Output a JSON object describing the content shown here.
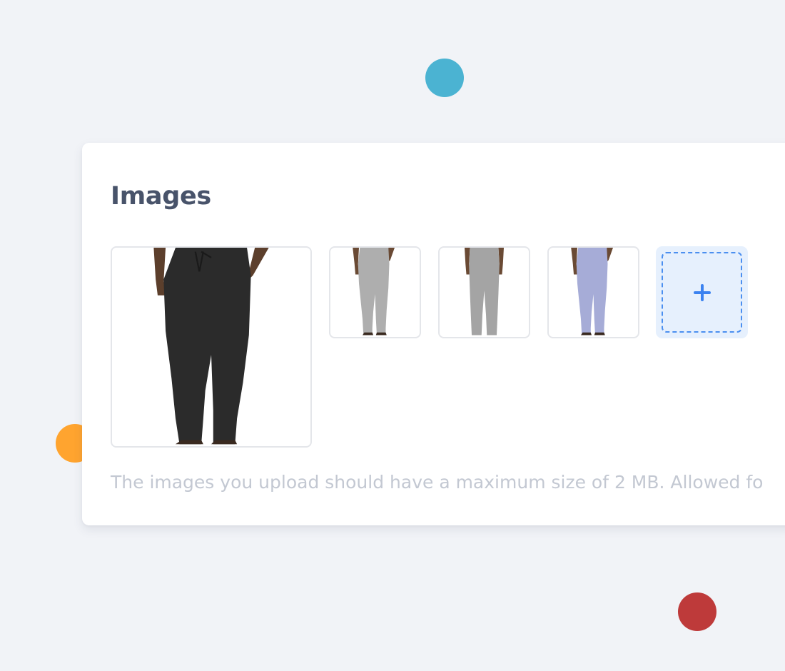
{
  "card": {
    "title": "Images",
    "hint": "The images you upload should have a maximum size of 2 MB. Allowed fo"
  },
  "images": [
    {
      "id": "main",
      "alt": "Black pants",
      "color": "#2b2b2b"
    },
    {
      "id": "s1",
      "alt": "Grey pants",
      "color": "#aeaeae"
    },
    {
      "id": "s2",
      "alt": "Grey pants",
      "color": "#a4a4a4"
    },
    {
      "id": "s3",
      "alt": "Lavender pants",
      "color": "#a6acd7"
    }
  ],
  "add_button": {
    "icon": "plus-icon"
  },
  "colors": {
    "background": "#f1f3f7",
    "accent_blue": "#3b82f0",
    "dot_blue": "#4bb3d2",
    "dot_orange": "#ffa42f",
    "dot_red": "#be3a3a"
  }
}
